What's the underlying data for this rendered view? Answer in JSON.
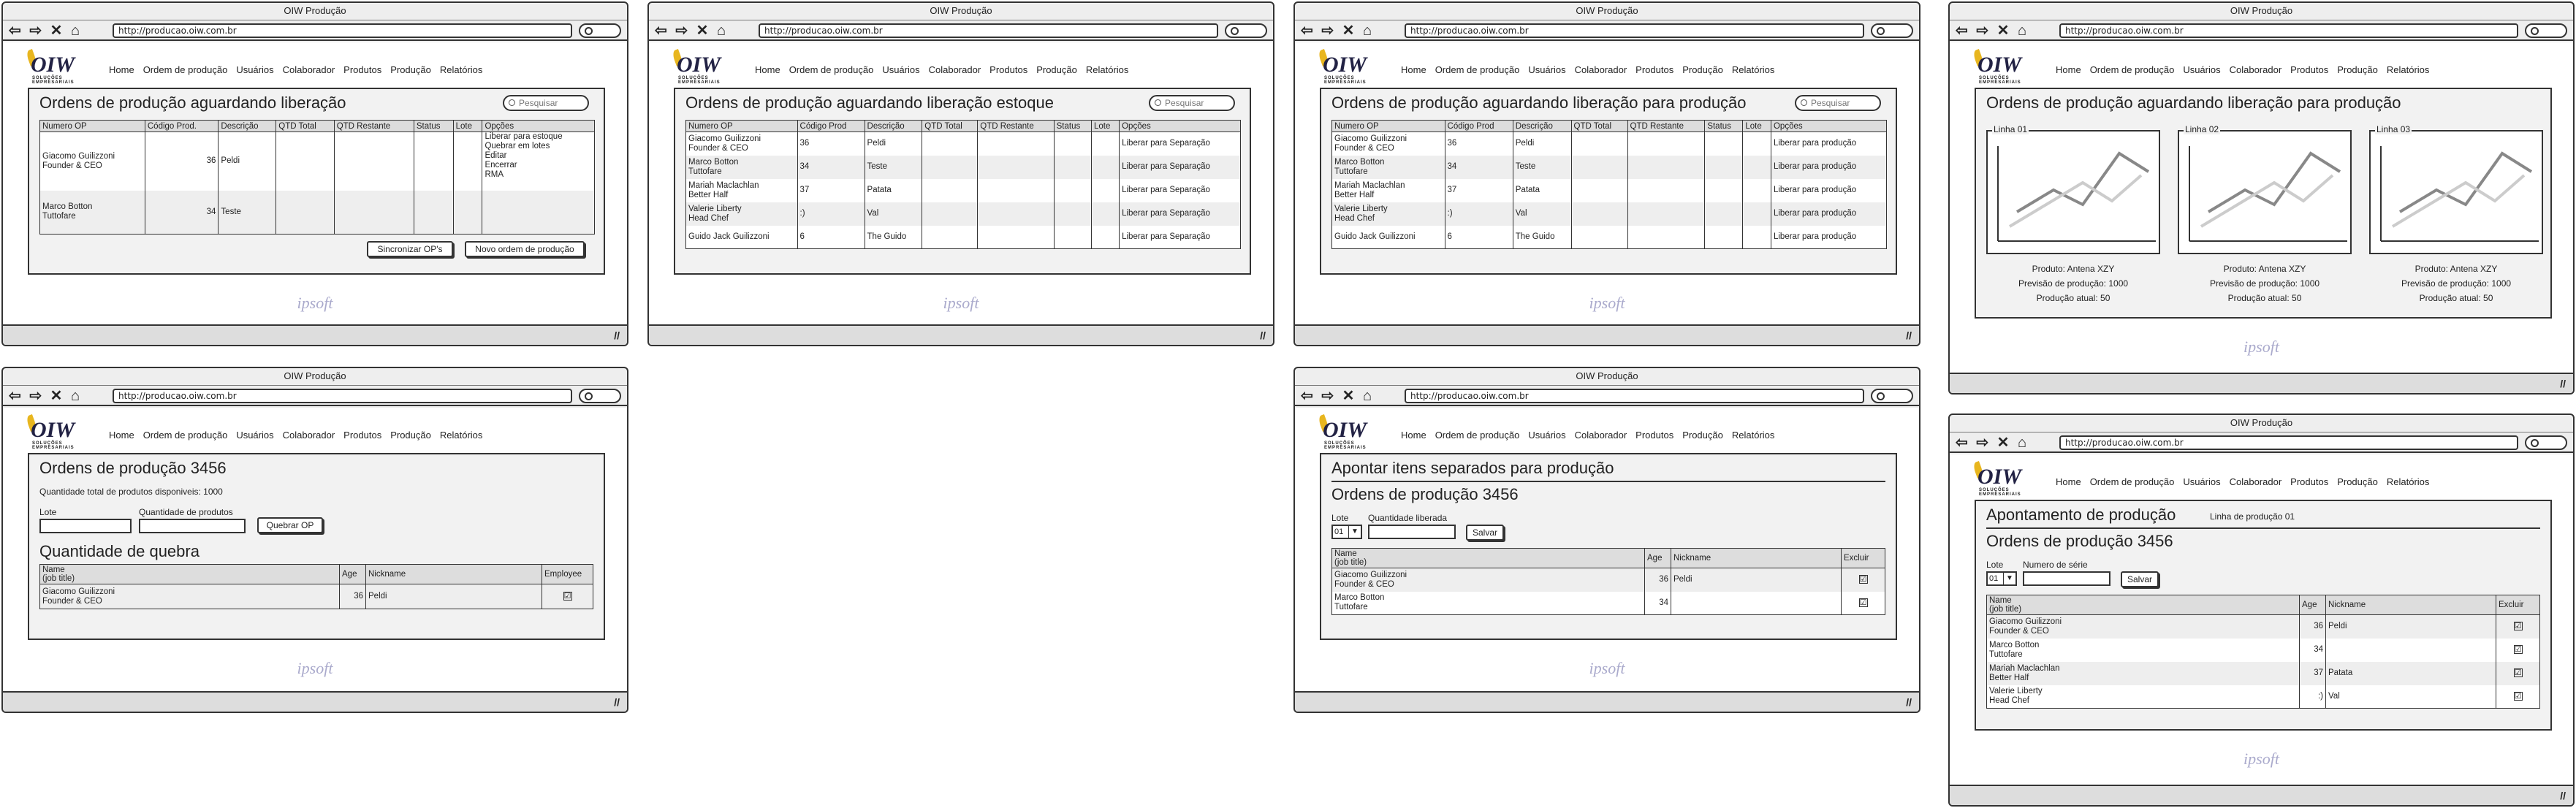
{
  "app": {
    "title": "OIW Produção",
    "url": "http://producao.oiw.com.br",
    "logo_text": "OIW",
    "logo_sub": "SOLUÇÕES EMPRESARIAIS",
    "footer_logo": "ipsoft",
    "nav_icons": "⇦ ⇨ ✕ ⌂"
  },
  "menu": [
    "Home",
    "Ordem de produção",
    "Usuários",
    "Colaborador",
    "Produtos",
    "Produção",
    "Relatórios"
  ],
  "search_placeholder": "Pesquisar",
  "screen1": {
    "title": "Ordens de produção aguardando liberação",
    "columns": [
      "Numero OP",
      "Código Prod.",
      "Descrição",
      "QTD Total",
      "QTD Restante",
      "Status",
      "Lote",
      "Opções"
    ],
    "rows": [
      {
        "numero": "Giacomo Guilizzoni\nFounder & CEO",
        "codigo": "36",
        "descricao": "Peldi",
        "opcoes": "Liberar para estoque\nQuebrar em lotes\nEditar\nEncerrar\nRMA"
      },
      {
        "numero": "Marco Botton\nTuttofare",
        "codigo": "34",
        "descricao": "Teste",
        "opcoes": ""
      }
    ],
    "btn_sync": "Sincronizar OP's",
    "btn_new": "Novo ordem de produção"
  },
  "screen2": {
    "title": "Ordens de produção aguardando liberação estoque",
    "columns": [
      "Numero OP",
      "Código Prod",
      "Descrição",
      "QTD Total",
      "QTD Restante",
      "Status",
      "Lote",
      "Opções"
    ],
    "rows": [
      {
        "numero": "Giacomo Guilizzoni\nFounder & CEO",
        "codigo": "36",
        "descricao": "Peldi",
        "opcoes": "Liberar para Separação"
      },
      {
        "numero": "Marco Botton\nTuttofare",
        "codigo": "34",
        "descricao": "Teste",
        "opcoes": "Liberar para Separação"
      },
      {
        "numero": "Mariah Maclachlan\nBetter Half",
        "codigo": "37",
        "descricao": "Patata",
        "opcoes": "Liberar para Separação"
      },
      {
        "numero": "Valerie Liberty\nHead Chef",
        "codigo": ":)",
        "descricao": "Val",
        "opcoes": "Liberar para Separação"
      },
      {
        "numero": "Guido Jack Guilizzoni",
        "codigo": "6",
        "descricao": "The Guido",
        "opcoes": "Liberar para Separação"
      }
    ]
  },
  "screen3": {
    "title": "Ordens de produção aguardando liberação para produção",
    "columns": [
      "Numero OP",
      "Código Prod",
      "Descrição",
      "QTD Total",
      "QTD Restante",
      "Status",
      "Lote",
      "Opções"
    ],
    "rows": [
      {
        "numero": "Giacomo Guilizzoni\nFounder & CEO",
        "codigo": "36",
        "descricao": "Peldi",
        "opcoes": "Liberar para produção"
      },
      {
        "numero": "Marco Botton\nTuttofare",
        "codigo": "34",
        "descricao": "Teste",
        "opcoes": "Liberar para produção"
      },
      {
        "numero": "Mariah Maclachlan\nBetter Half",
        "codigo": "37",
        "descricao": "Patata",
        "opcoes": "Liberar para produção"
      },
      {
        "numero": "Valerie Liberty\nHead Chef",
        "codigo": ":)",
        "descricao": "Val",
        "opcoes": "Liberar para produção"
      },
      {
        "numero": "Guido Jack Guilizzoni",
        "codigo": "6",
        "descricao": "The Guido",
        "opcoes": "Liberar para produção"
      }
    ]
  },
  "screen4": {
    "title": "Ordens de produção aguardando liberação para produção",
    "lines": [
      {
        "name": "Linha 01",
        "produto": "Produto: Antena XZY",
        "previsao": "Previsão de produção: 1000",
        "atual": "Produção atual: 50"
      },
      {
        "name": "Linha 02",
        "produto": "Produto: Antena XZY",
        "previsao": "Previsão de produção: 1000",
        "atual": "Produção atual: 50"
      },
      {
        "name": "Linha 03",
        "produto": "Produto: Antena XZY",
        "previsao": "Previsão de produção: 1000",
        "atual": "Produção atual: 50"
      }
    ]
  },
  "screen5": {
    "title": "Ordens de produção 3456",
    "info": "Quantidade total de produtos disponiveis: 1000",
    "lote_label": "Lote",
    "qtd_label": "Quantidade de produtos",
    "btn": "Quebrar OP",
    "subtitle": "Quantidade de quebra",
    "columns": [
      "Name\n(job title)",
      "Age",
      "Nickname",
      "Employee"
    ],
    "rows": [
      {
        "name": "Giacomo Guilizzoni\nFounder & CEO",
        "age": "36",
        "nick": "Peldi",
        "check": "☑"
      }
    ]
  },
  "screen6": {
    "title": "Apontar itens separados para produção",
    "subtitle": "Ordens de produção 3456",
    "lote_label": "Lote",
    "lote_value": "01",
    "qtd_label": "Quantidade liberada",
    "btn": "Salvar",
    "columns": [
      "Name\n(job title)",
      "Age",
      "Nickname",
      "Excluir"
    ],
    "rows": [
      {
        "name": "Giacomo Guilizzoni\nFounder & CEO",
        "age": "36",
        "nick": "Peldi",
        "check": "☑"
      },
      {
        "name": "Marco Botton\nTuttofare",
        "age": "34",
        "nick": "",
        "check": "☑"
      }
    ]
  },
  "screen7": {
    "title": "Apontamento de produção",
    "line_label": "Linha de produção 01",
    "subtitle": "Ordens de produção 3456",
    "lote_label": "Lote",
    "lote_value": "01",
    "serie_label": "Numero de série",
    "btn": "Salvar",
    "columns": [
      "Name\n(job title)",
      "Age",
      "Nickname",
      "Excluir"
    ],
    "rows": [
      {
        "name": "Giacomo Guilizzoni\nFounder & CEO",
        "age": "36",
        "nick": "Peldi",
        "check": "☑"
      },
      {
        "name": "Marco Botton\nTuttofare",
        "age": "34",
        "nick": "",
        "check": "☑"
      },
      {
        "name": "Mariah Maclachlan\nBetter Half",
        "age": "37",
        "nick": "Patata",
        "check": "☑"
      },
      {
        "name": "Valerie Liberty\nHead Chef",
        "age": ":)",
        "nick": "Val",
        "check": "☑"
      }
    ]
  }
}
